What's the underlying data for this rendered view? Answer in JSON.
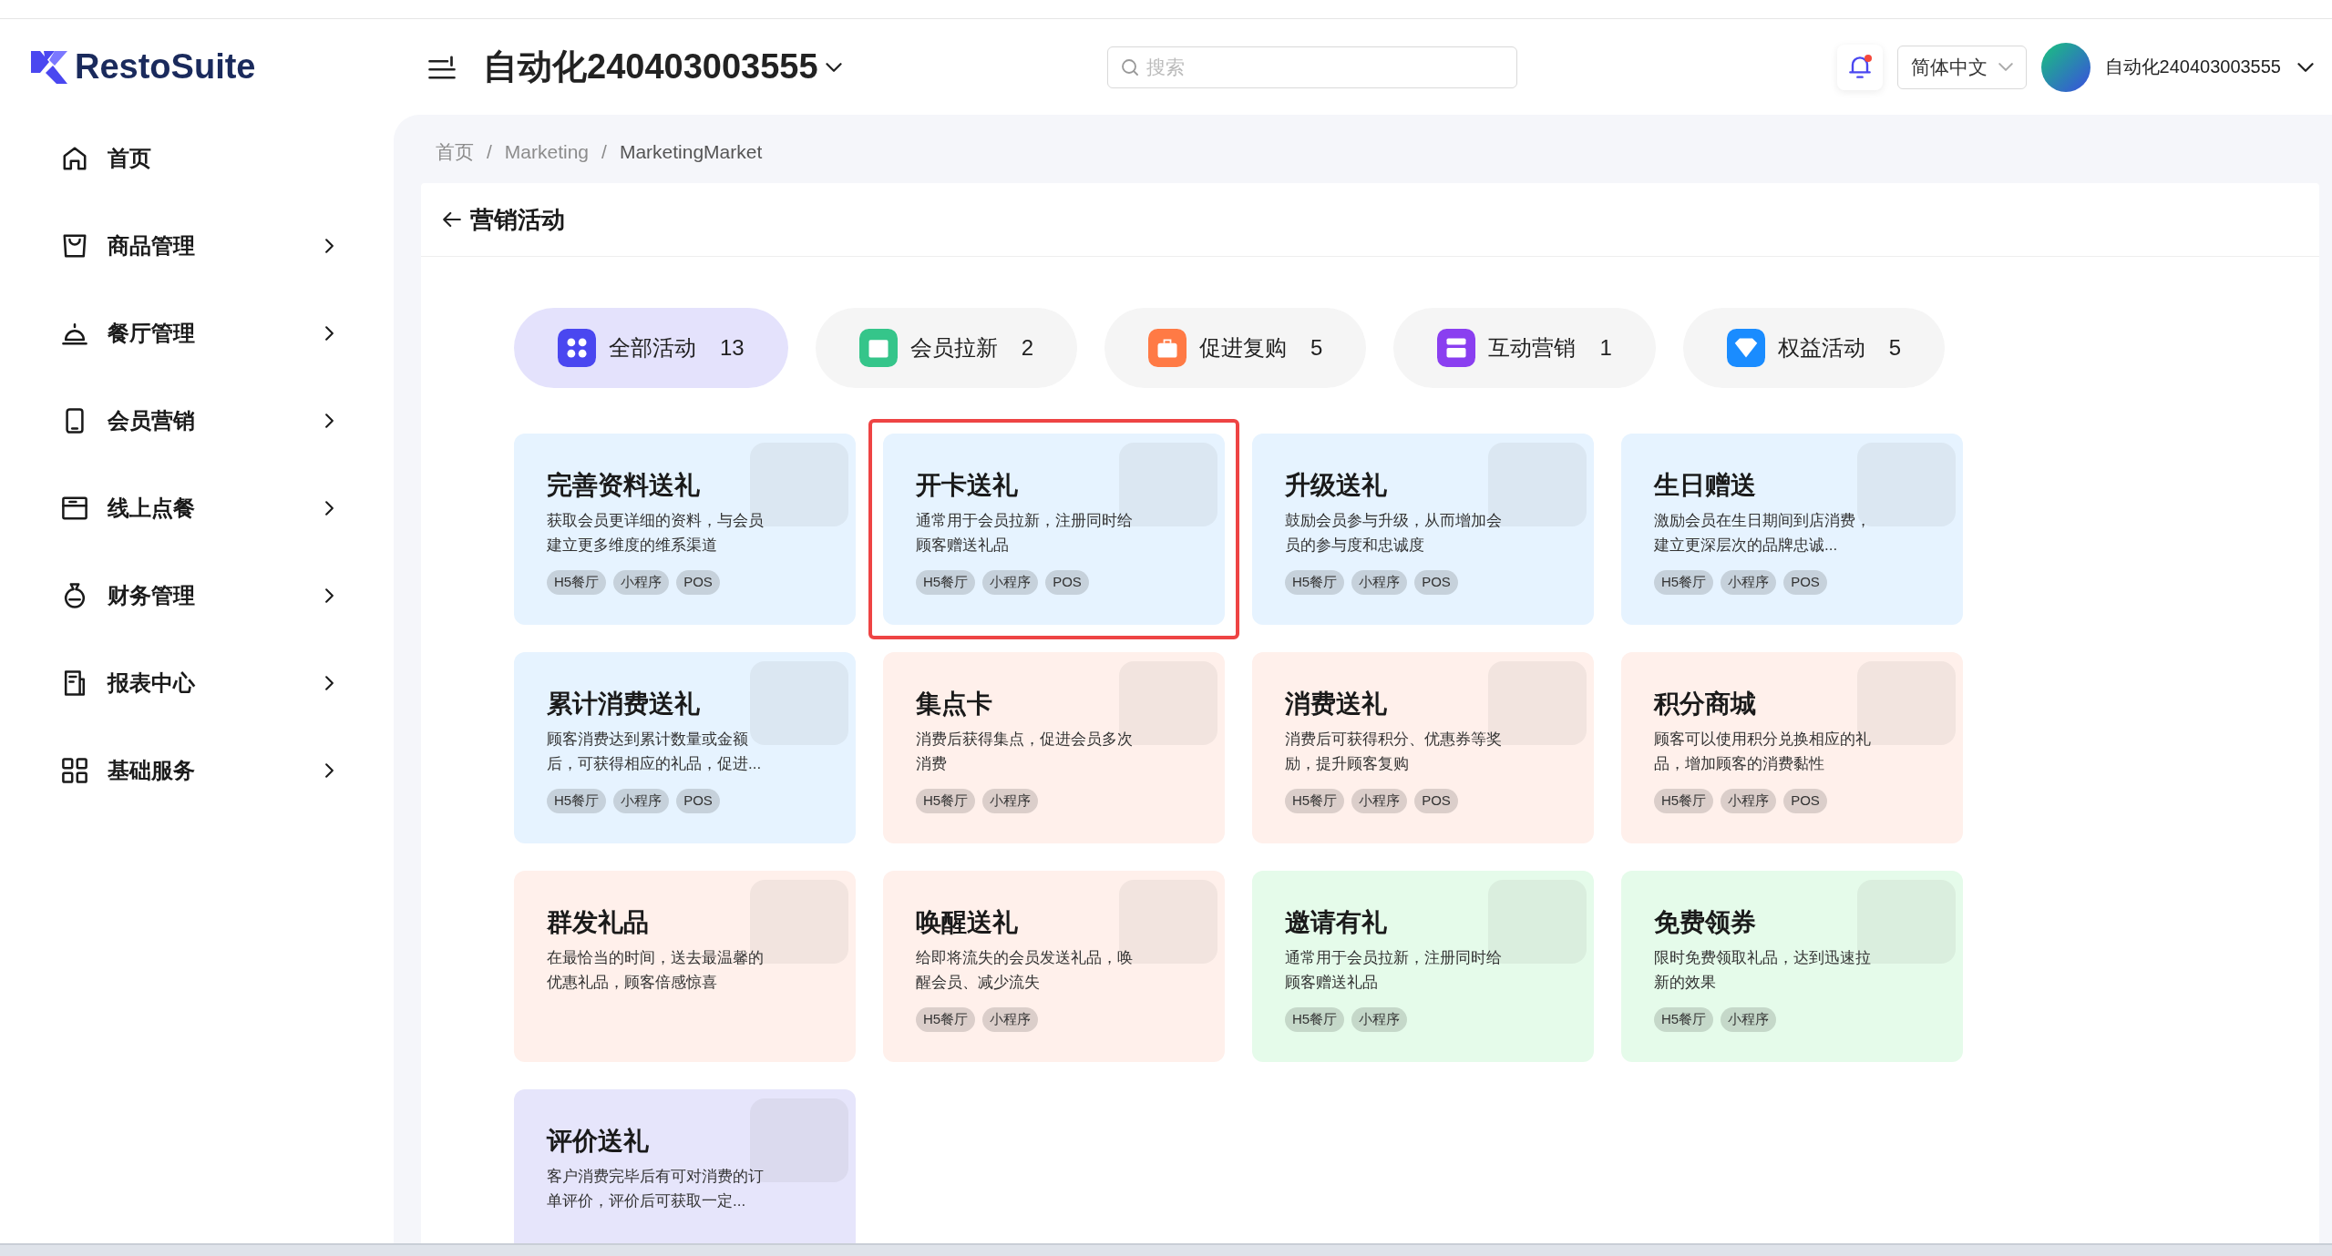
{
  "header": {
    "logo": "RestoSuite",
    "store_name": "自动化240403003555",
    "search": {
      "placeholder": "搜索"
    },
    "notification_dot": true,
    "language": "简体中文",
    "user_name": "自动化240403003555"
  },
  "sidebar": {
    "items": [
      {
        "label": "首页",
        "expandable": false
      },
      {
        "label": "商品管理",
        "expandable": true
      },
      {
        "label": "餐厅管理",
        "expandable": true
      },
      {
        "label": "会员营销",
        "expandable": true
      },
      {
        "label": "线上点餐",
        "expandable": true
      },
      {
        "label": "财务管理",
        "expandable": true
      },
      {
        "label": "报表中心",
        "expandable": true
      },
      {
        "label": "基础服务",
        "expandable": true
      }
    ]
  },
  "breadcrumb": [
    {
      "kind": "link",
      "text": "首页"
    },
    {
      "kind": "separator",
      "text": "/"
    },
    {
      "kind": "link",
      "text": "Marketing"
    },
    {
      "kind": "separator",
      "text": "/"
    },
    {
      "kind": "current",
      "text": "MarketingMarket"
    }
  ],
  "page_title": "营销活动",
  "tabs": [
    {
      "label": "全部活动",
      "count": "13",
      "color": "#4a47f0",
      "selected": true
    },
    {
      "label": "会员拉新",
      "count": "2",
      "color": "#35c58a",
      "selected": false
    },
    {
      "label": "促进复购",
      "count": "5",
      "color": "#ff7a45",
      "selected": false
    },
    {
      "label": "互动营销",
      "count": "1",
      "color": "#8a3ff0",
      "selected": false
    },
    {
      "label": "权益活动",
      "count": "5",
      "color": "#1a8cff",
      "selected": false
    }
  ],
  "cards": [
    {
      "title": "完善资料送礼",
      "description": "获取会员更详细的资料，与会员建立更多维度的维系渠道",
      "tags": [
        "H5餐厅",
        "小程序",
        "POS"
      ],
      "color": "#e6f3ff",
      "selected": false
    },
    {
      "title": "开卡送礼",
      "description": "通常用于会员拉新，注册同时给顾客赠送礼品",
      "tags": [
        "H5餐厅",
        "小程序",
        "POS"
      ],
      "color": "#e6f3ff",
      "selected": true
    },
    {
      "title": "升级送礼",
      "description": "鼓励会员参与升级，从而增加会员的参与度和忠诚度",
      "tags": [
        "H5餐厅",
        "小程序",
        "POS"
      ],
      "color": "#e6f3ff",
      "selected": false
    },
    {
      "title": "生日赠送",
      "description": "激励会员在生日期间到店消费，建立更深层次的品牌忠诚...",
      "tags": [
        "H5餐厅",
        "小程序",
        "POS"
      ],
      "color": "#e6f3ff",
      "selected": false
    },
    {
      "title": "累计消费送礼",
      "description": "顾客消费达到累计数量或金额后，可获得相应的礼品，促进...",
      "tags": [
        "H5餐厅",
        "小程序",
        "POS"
      ],
      "color": "#e6f3ff",
      "selected": false
    },
    {
      "title": "集点卡",
      "description": "消费后获得集点，促进会员多次消费",
      "tags": [
        "H5餐厅",
        "小程序"
      ],
      "color": "#fff0eb",
      "selected": false
    },
    {
      "title": "消费送礼",
      "description": "消费后可获得积分、优惠券等奖励，提升顾客复购",
      "tags": [
        "H5餐厅",
        "小程序",
        "POS"
      ],
      "color": "#fff0eb",
      "selected": false
    },
    {
      "title": "积分商城",
      "description": "顾客可以使用积分兑换相应的礼品，增加顾客的消费黏性",
      "tags": [
        "H5餐厅",
        "小程序",
        "POS"
      ],
      "color": "#fff0eb",
      "selected": false
    },
    {
      "title": "群发礼品",
      "description": "在最恰当的时间，送去最温馨的优惠礼品，顾客倍感惊喜",
      "color": "#fff0eb",
      "selected": false
    },
    {
      "title": "唤醒送礼",
      "description": "给即将流失的会员发送礼品，唤醒会员、减少流失",
      "tags": [
        "H5餐厅",
        "小程序"
      ],
      "color": "#fff0eb",
      "selected": false
    },
    {
      "title": "邀请有礼",
      "description": "通常用于会员拉新，注册同时给顾客赠送礼品",
      "tags": [
        "H5餐厅",
        "小程序"
      ],
      "color": "#e5fbea",
      "selected": false
    },
    {
      "title": "免费领券",
      "description": "限时免费领取礼品，达到迅速拉新的效果",
      "tags": [
        "H5餐厅",
        "小程序"
      ],
      "color": "#e5fbea",
      "selected": false
    },
    {
      "title": "评价送礼",
      "description": "客户消费完毕后有可对消费的订单评价，评价后可获取一定...",
      "color": "#e6e5fb",
      "selected": false
    }
  ]
}
